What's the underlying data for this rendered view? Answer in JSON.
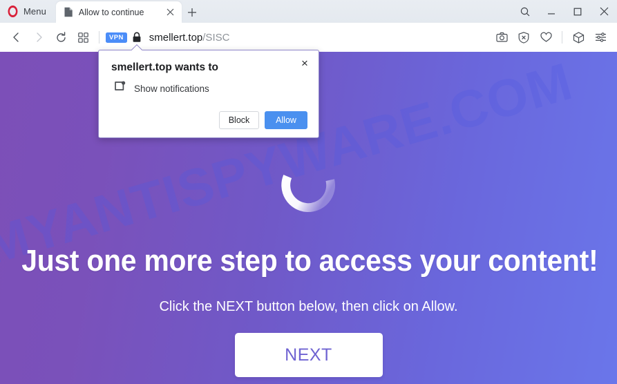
{
  "browser": {
    "menu_label": "Menu",
    "tab": {
      "title": "Allow to continue",
      "favicon": "document-icon",
      "close": "×"
    },
    "new_tab": "+",
    "window_controls": {
      "search": "search-icon",
      "minimize": "minimize-icon",
      "maximize": "maximize-icon",
      "close": "close-icon"
    },
    "toolbar": {
      "back": "back-arrow-icon",
      "forward": "forward-arrow-icon",
      "reload": "reload-icon",
      "tab_overview": "grid-icon",
      "vpn_badge": "VPN",
      "lock": "padlock-icon",
      "url_host": "smellert.top",
      "url_path": "/SISC",
      "right_icons": [
        "snapshot-camera-icon",
        "ad-blocker-shield-icon",
        "heart-icon",
        "extensions-cube-icon",
        "easy-setup-sliders-icon"
      ]
    }
  },
  "permission_popup": {
    "title": "smellert.top wants to",
    "permission_icon": "notification-bubble-icon",
    "permission_label": "Show notifications",
    "block_label": "Block",
    "allow_label": "Allow",
    "close_label": "×"
  },
  "page": {
    "watermark": "MYANTISPYWARE.COM",
    "spinner": "loading-spinner",
    "headline": "Just one more step to access your content!",
    "subline": "Click the NEXT button below, then click on Allow.",
    "next_label": "NEXT"
  },
  "colors": {
    "gradient_left": "#7C4FB8",
    "gradient_right": "#6A76EA",
    "accent_blue": "#4A90EF",
    "opera_red": "#D9213A",
    "vpn_blue": "#4B8DF8",
    "next_text": "#6F63D2",
    "watermark": "#4E58E1"
  }
}
